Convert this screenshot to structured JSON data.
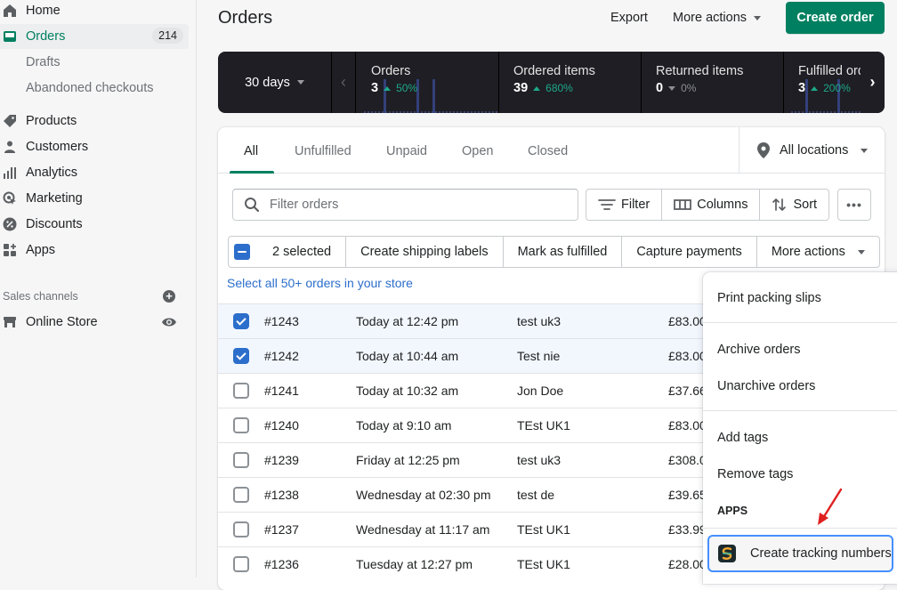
{
  "sidebar": {
    "home": "Home",
    "orders": "Orders",
    "orders_count": "214",
    "drafts": "Drafts",
    "abandoned": "Abandoned checkouts",
    "products": "Products",
    "customers": "Customers",
    "analytics": "Analytics",
    "marketing": "Marketing",
    "discounts": "Discounts",
    "apps": "Apps",
    "sales_channels_label": "Sales channels",
    "online_store": "Online Store"
  },
  "header": {
    "title": "Orders",
    "export": "Export",
    "more_actions": "More actions",
    "create_order": "Create order"
  },
  "metrics": {
    "period": "30 days",
    "items": [
      {
        "label": "Orders",
        "value": "3",
        "delta": "50%",
        "direction": "up"
      },
      {
        "label": "Ordered items",
        "value": "39",
        "delta": "680%",
        "direction": "up"
      },
      {
        "label": "Returned items",
        "value": "0",
        "delta": "0%",
        "direction": "down"
      },
      {
        "label": "Fulfilled orders",
        "value": "3",
        "delta": "200%",
        "direction": "up"
      }
    ]
  },
  "tabs": [
    "All",
    "Unfulfilled",
    "Unpaid",
    "Open",
    "Closed"
  ],
  "active_tab": "All",
  "location": "All locations",
  "filter": {
    "placeholder": "Filter orders",
    "value": "",
    "filter_label": "Filter",
    "columns_label": "Columns",
    "sort_label": "Sort"
  },
  "bulk": {
    "selected": "2 selected",
    "create_labels": "Create shipping labels",
    "mark_fulfilled": "Mark as fulfilled",
    "capture": "Capture payments",
    "more_actions": "More actions",
    "select_all": "Select all 50+ orders in your store"
  },
  "orders": [
    {
      "number": "#1243",
      "date": "Today at 12:42 pm",
      "customer": "test uk3",
      "total": "£83.00",
      "checked": true
    },
    {
      "number": "#1242",
      "date": "Today at 10:44 am",
      "customer": "Test nie",
      "total": "£83.00",
      "checked": true
    },
    {
      "number": "#1241",
      "date": "Today at 10:32 am",
      "customer": "Jon Doe",
      "total": "£37.66",
      "checked": false
    },
    {
      "number": "#1240",
      "date": "Today at 9:10 am",
      "customer": "TEst UK1",
      "total": "£83.00",
      "checked": false
    },
    {
      "number": "#1239",
      "date": "Friday at 12:25 pm",
      "customer": "test uk3",
      "total": "£308.0",
      "checked": false
    },
    {
      "number": "#1238",
      "date": "Wednesday at 02:30 pm",
      "customer": "test de",
      "total": "£39.65",
      "checked": false
    },
    {
      "number": "#1237",
      "date": "Wednesday at 11:17 am",
      "customer": "TEst UK1",
      "total": "£33.99",
      "checked": false
    },
    {
      "number": "#1236",
      "date": "Tuesday at 12:27 pm",
      "customer": "TEst UK1",
      "total": "£28.00",
      "checked": false
    }
  ],
  "dropdown": {
    "print_slips": "Print packing slips",
    "archive": "Archive orders",
    "unarchive": "Unarchive orders",
    "add_tags": "Add tags",
    "remove_tags": "Remove tags",
    "apps_heading": "APPS",
    "create_tracking": "Create tracking numbers"
  },
  "colors": {
    "brand": "#008060",
    "selection": "#2c6ecb",
    "positive": "#1ea889",
    "annotation": "#e02020"
  }
}
